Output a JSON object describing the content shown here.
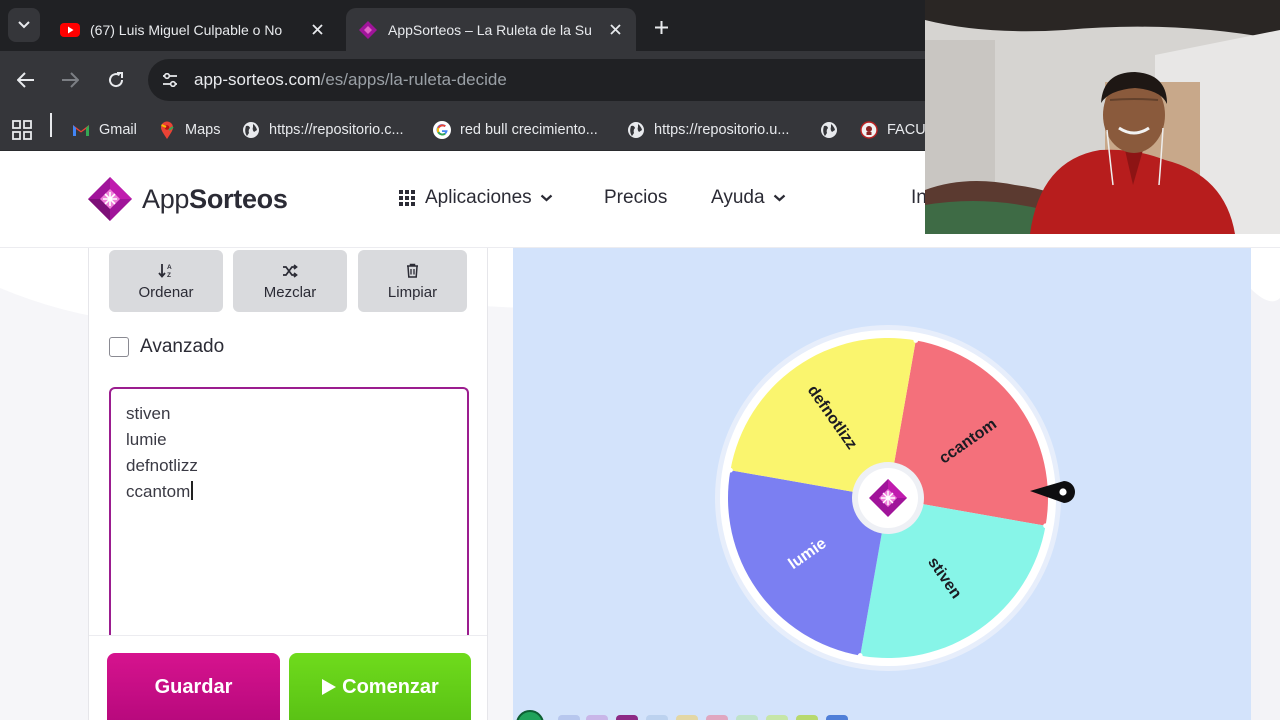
{
  "browser": {
    "tabs": [
      {
        "title": "(67) Luis Miguel Culpable o No",
        "icon": "youtube-icon",
        "active": false
      },
      {
        "title": "AppSorteos – La Ruleta de la Su",
        "icon": "appsorteos-icon",
        "active": true
      }
    ],
    "url_host": "app-sorteos.com",
    "url_path": "/es/apps/la-ruleta-decide",
    "bookmarks": [
      {
        "label": "Gmail",
        "icon": "gmail-icon"
      },
      {
        "label": "Maps",
        "icon": "maps-icon"
      },
      {
        "label": "https://repositorio.c...",
        "icon": "globe-icon"
      },
      {
        "label": "red bull crecimiento...",
        "icon": "google-icon"
      },
      {
        "label": "https://repositorio.u...",
        "icon": "globe-icon"
      },
      {
        "label": "",
        "icon": "globe-icon"
      },
      {
        "label": "FACU",
        "icon": "university-icon"
      }
    ]
  },
  "site": {
    "brand_light": "App",
    "brand_bold": "Sorteos",
    "nav": {
      "apps": "Aplicaciones",
      "pricing": "Precios",
      "help": "Ayuda",
      "cut": "In"
    }
  },
  "panel": {
    "tools": {
      "sort": "Ordenar",
      "shuffle": "Mezclar",
      "clear": "Limpiar"
    },
    "advanced_label": "Avanzado",
    "advanced_checked": false,
    "names": [
      "stiven",
      "lumie",
      "defnotlizz",
      "ccantom"
    ],
    "save_label": "Guardar",
    "start_label": "Comenzar"
  },
  "wheel": {
    "segments": [
      {
        "label": "ccantom",
        "color": "#f4707b"
      },
      {
        "label": "stiven",
        "color": "#87f5e8"
      },
      {
        "label": "lumie",
        "color": "#7b7ff2"
      },
      {
        "label": "defnotlizz",
        "color": "#faf56e"
      }
    ],
    "background": "#d3e3fb",
    "accent": "#a0149a"
  }
}
